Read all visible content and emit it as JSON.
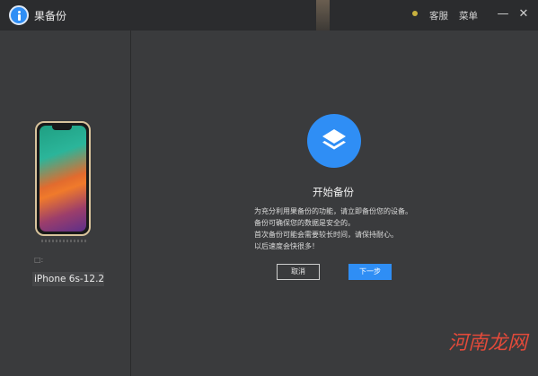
{
  "app": {
    "title": "果备份"
  },
  "titlebar": {
    "service_label": "客服",
    "menu_label": "菜单",
    "minimize_glyph": "—",
    "close_glyph": "✕",
    "logo_icon": "info-icon",
    "accent_color": "#2f8ef5"
  },
  "device": {
    "small_label": "□:",
    "name": "iPhone 6s-12.2"
  },
  "main": {
    "heading": "开始备份",
    "description": [
      "为充分利用果备份的功能，请立即备份您的设备。",
      "备份可确保您的数据是安全的。",
      "首次备份可能会需要较长时间，请保持耐心。",
      "以后速度会快很多！"
    ],
    "cancel_label": "取消",
    "next_label": "下一步",
    "hero_icon": "layers-icon"
  },
  "watermark": {
    "text": "河南龙网"
  }
}
